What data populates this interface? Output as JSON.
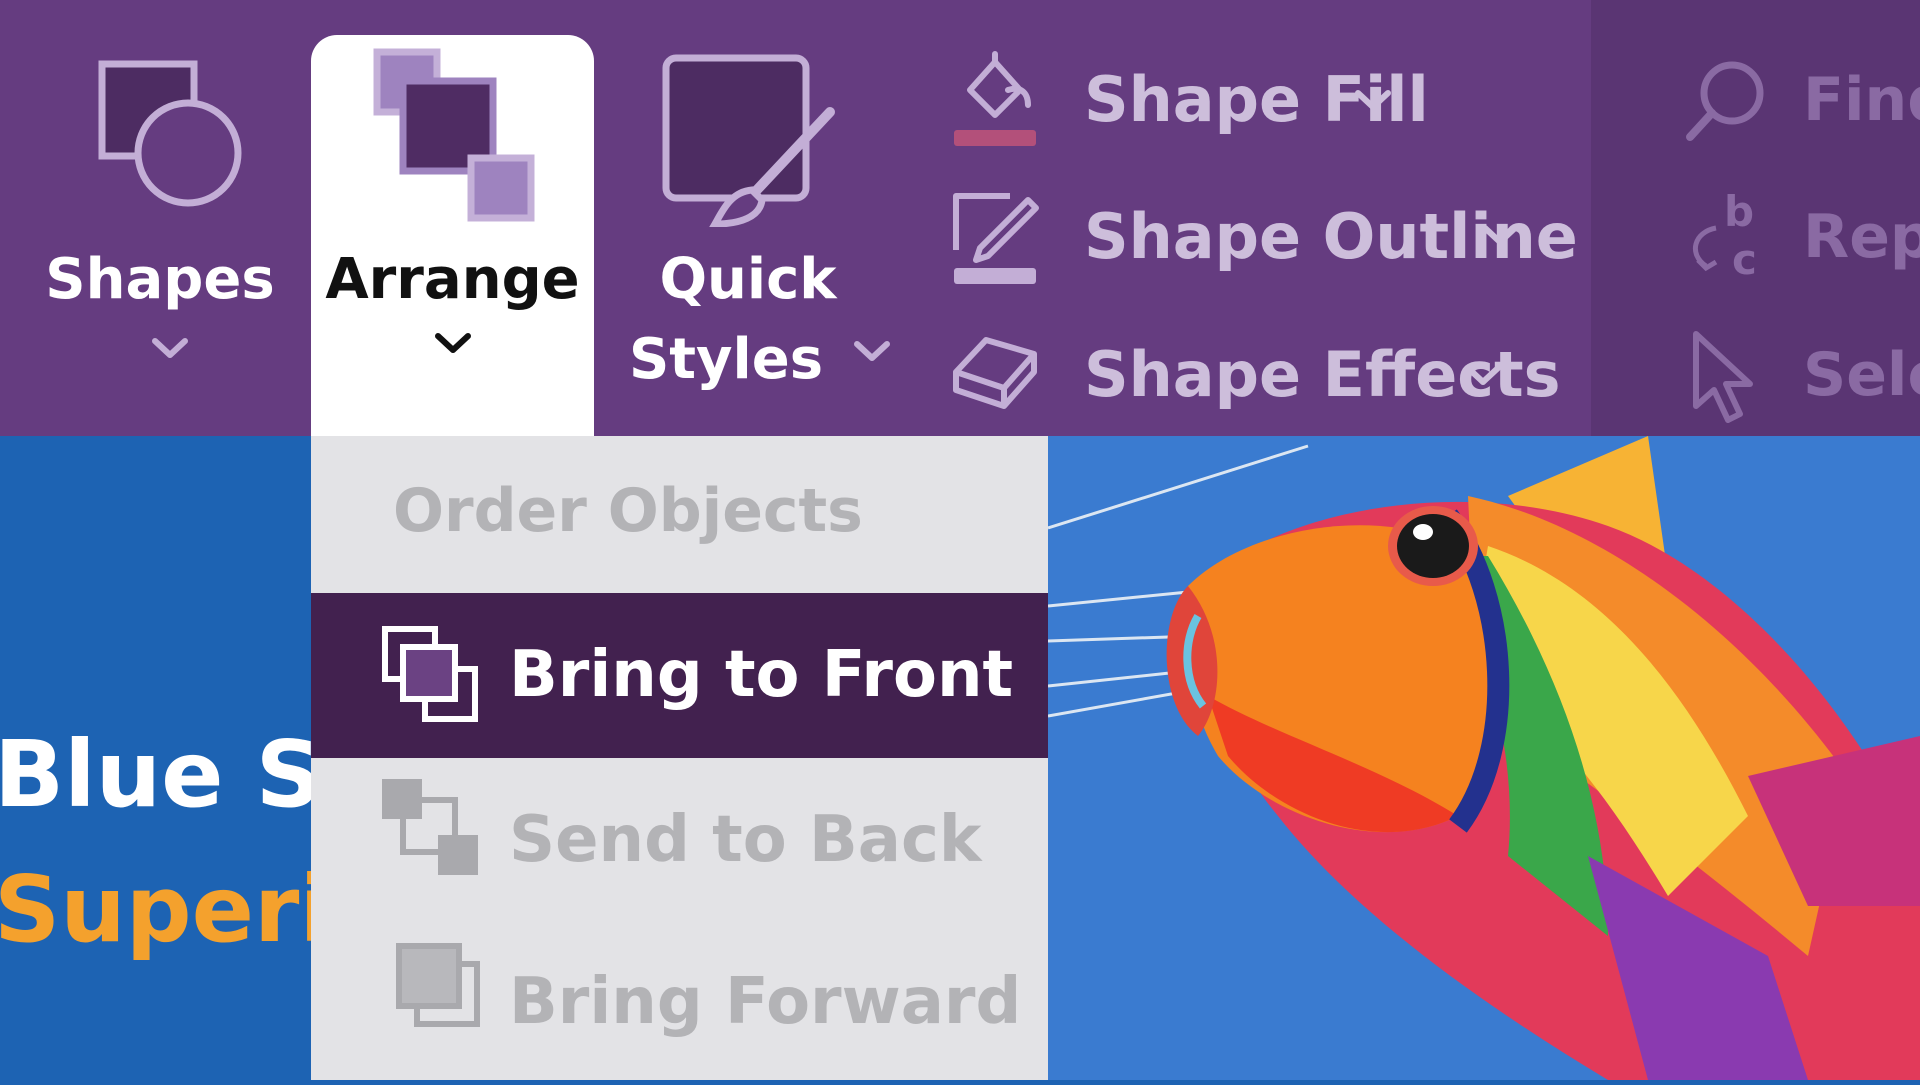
{
  "ribbon": {
    "shapes_label": "Shapes",
    "arrange_label": "Arrange",
    "quick_styles_label_1": "Quick",
    "quick_styles_label_2": "Styles",
    "shape_fill_label": "Shape Fill",
    "shape_outline_label": "Shape Outline",
    "shape_effects_label": "Shape Effects",
    "find_label": "Find",
    "replace_label": "Repl",
    "select_label": "Sele"
  },
  "arrange_menu": {
    "header": "Order Objects",
    "items": [
      {
        "label": "Bring to Front",
        "state": "highlighted"
      },
      {
        "label": "Send to Back",
        "state": "normal"
      },
      {
        "label": "Bring Forward",
        "state": "normal"
      }
    ]
  },
  "slide": {
    "title_line": "Blue S",
    "subtitle_line": "Superi"
  },
  "colors": {
    "ribbon": "#653c80",
    "highlight": "#42214f",
    "slide_bg": "#1d63b3",
    "subtitle": "#f4a12d"
  },
  "icons": [
    "shapes-icon",
    "arrange-icon",
    "quick-styles-icon",
    "shape-fill-icon",
    "shape-outline-icon",
    "shape-effects-icon",
    "find-icon",
    "replace-icon",
    "select-icon",
    "bring-to-front-icon",
    "send-to-back-icon",
    "bring-forward-icon"
  ]
}
